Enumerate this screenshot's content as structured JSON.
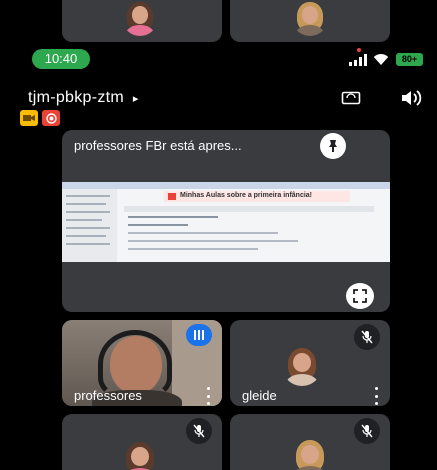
{
  "status_bar": {
    "time": "10:40",
    "battery": "80+"
  },
  "meeting": {
    "code": "tjm-pbkp-ztm",
    "code_chevron": "▸"
  },
  "presentation": {
    "title": "professores FBr está apres...",
    "slide_heading": "Minhas Aulas sobre a primeira infância!"
  },
  "participants": [
    {
      "name": "professores",
      "muted": false,
      "speaking": true
    },
    {
      "name": "gleide",
      "muted": true,
      "speaking": false
    },
    {
      "name": "",
      "muted": true,
      "speaking": false
    },
    {
      "name": "",
      "muted": true,
      "speaking": false
    }
  ],
  "colors": {
    "background": "#000000",
    "tile": "#3b3c3f",
    "time_pill": "#2ea84f",
    "speaking_badge": "#1a73e8",
    "red_badge": "#ea4335",
    "yellow_badge": "#fbbc04"
  },
  "icons": {
    "rotate": "rotate-screen-icon",
    "speaker": "speaker-icon",
    "pin": "pin-icon",
    "fullscreen": "fullscreen-icon",
    "mic_off": "mic-off-icon",
    "signal": "signal-icon",
    "wifi": "wifi-icon"
  }
}
